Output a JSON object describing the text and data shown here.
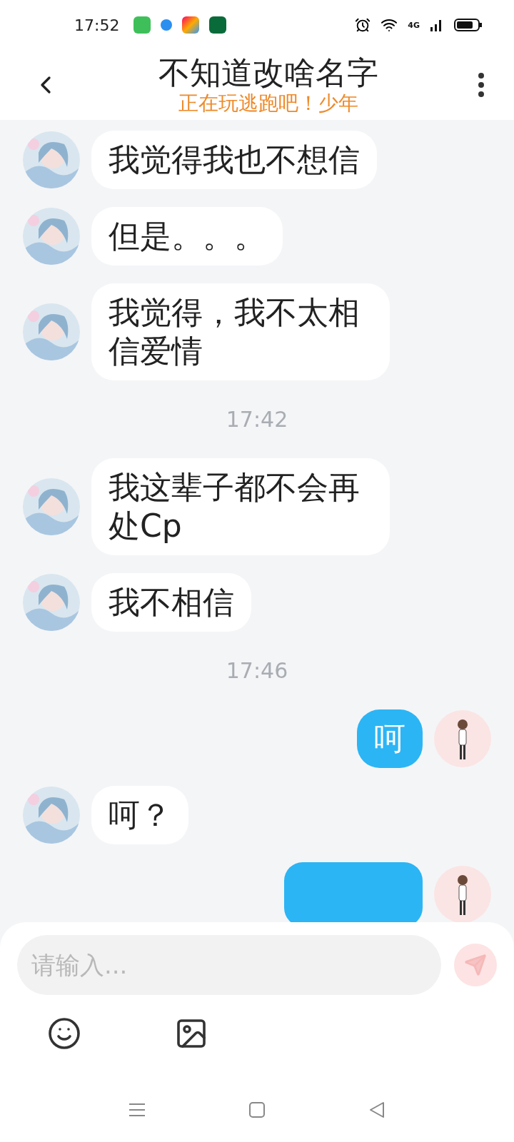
{
  "status_bar": {
    "time": "17:52",
    "network": "4G"
  },
  "header": {
    "title": "不知道改啥名字",
    "subtitle": "正在玩逃跑吧！少年"
  },
  "messages": [
    {
      "kind": "message",
      "from_me": false,
      "text": "我觉得我也不想信"
    },
    {
      "kind": "message",
      "from_me": false,
      "text": "但是。。。"
    },
    {
      "kind": "message",
      "from_me": false,
      "text": "我觉得，我不太相信爱情"
    },
    {
      "kind": "time",
      "text": "17:42"
    },
    {
      "kind": "message",
      "from_me": false,
      "text": "我这辈子都不会再处Cp"
    },
    {
      "kind": "message",
      "from_me": false,
      "text": "我不相信"
    },
    {
      "kind": "time",
      "text": "17:46"
    },
    {
      "kind": "message",
      "from_me": true,
      "text": "呵"
    },
    {
      "kind": "message",
      "from_me": false,
      "text": "呵？"
    },
    {
      "kind": "message",
      "from_me": true
    }
  ],
  "composer": {
    "placeholder": "请输入..."
  }
}
